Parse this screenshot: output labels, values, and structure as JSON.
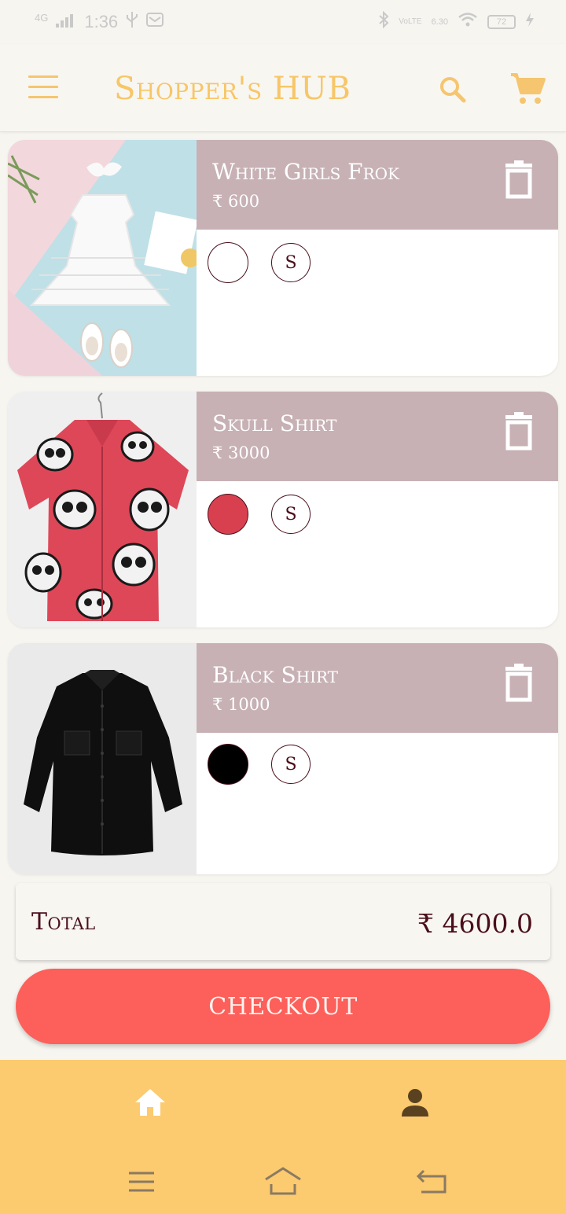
{
  "status_bar": {
    "network": "4G",
    "time": "1:36",
    "data_speed": "6.30",
    "battery": "72"
  },
  "app_bar": {
    "title": "Shopper's HUB"
  },
  "cart_items": [
    {
      "name": "White Girls Frok",
      "price": "₹ 600",
      "color": "#ffffff",
      "size": "S"
    },
    {
      "name": "Skull Shirt",
      "price": "₹ 3000",
      "color": "#d9404f",
      "size": "S"
    },
    {
      "name": "Black Shirt",
      "price": "₹ 1000",
      "color": "#000000",
      "size": "S"
    }
  ],
  "summary": {
    "total_label": "Total",
    "total_value": "₹ 4600.0",
    "checkout_label": "CHECKOUT"
  },
  "colors": {
    "accent": "#f7c667",
    "header": "#c7b1b5",
    "checkout": "#fd5f5a",
    "text": "#4a0e1a",
    "bottom_nav": "#fcca6f"
  }
}
